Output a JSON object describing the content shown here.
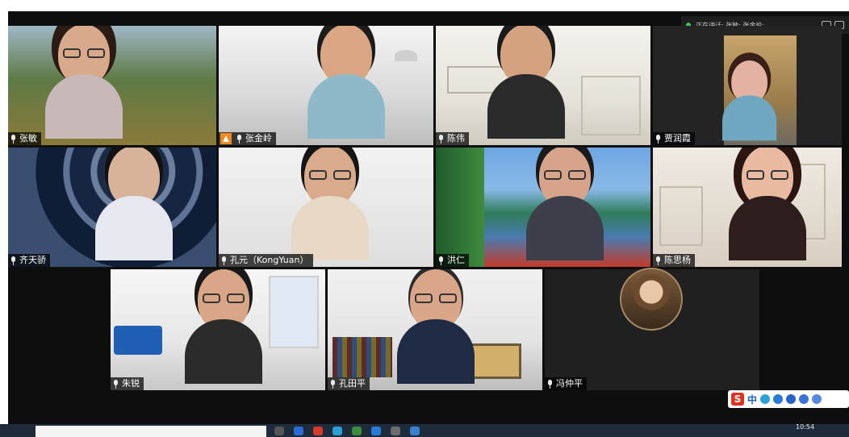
{
  "header": {
    "speaking_text": "正在讲话: 张敏; 张金岭;"
  },
  "participants": [
    {
      "name": "张敏",
      "mic_icon": "unmuted-mic-icon"
    },
    {
      "name": "张金岭",
      "mic_icon": "unmuted-mic-icon",
      "host_icon": "host-icon"
    },
    {
      "name": "陈伟",
      "mic_icon": "unmuted-mic-icon"
    },
    {
      "name": "贾润霞",
      "mic_icon": "unmuted-mic-icon"
    },
    {
      "name": "齐天骄",
      "mic_icon": "unmuted-mic-icon"
    },
    {
      "name": "孔元（KongYuan）",
      "mic_icon": "unmuted-mic-icon"
    },
    {
      "name": "洪仁",
      "mic_icon": "unmuted-mic-icon"
    },
    {
      "name": "陈思杨",
      "mic_icon": "unmuted-mic-icon"
    },
    {
      "name": "朱锐",
      "mic_icon": "unmuted-mic-icon"
    },
    {
      "name": "孔田平",
      "mic_icon": "unmuted-mic-icon"
    },
    {
      "name": "冯仲平",
      "mic_icon": "unmuted-mic-icon"
    }
  ],
  "ime": {
    "logo": "S",
    "mode": "中"
  },
  "taskbar": {
    "time": "10:54"
  }
}
